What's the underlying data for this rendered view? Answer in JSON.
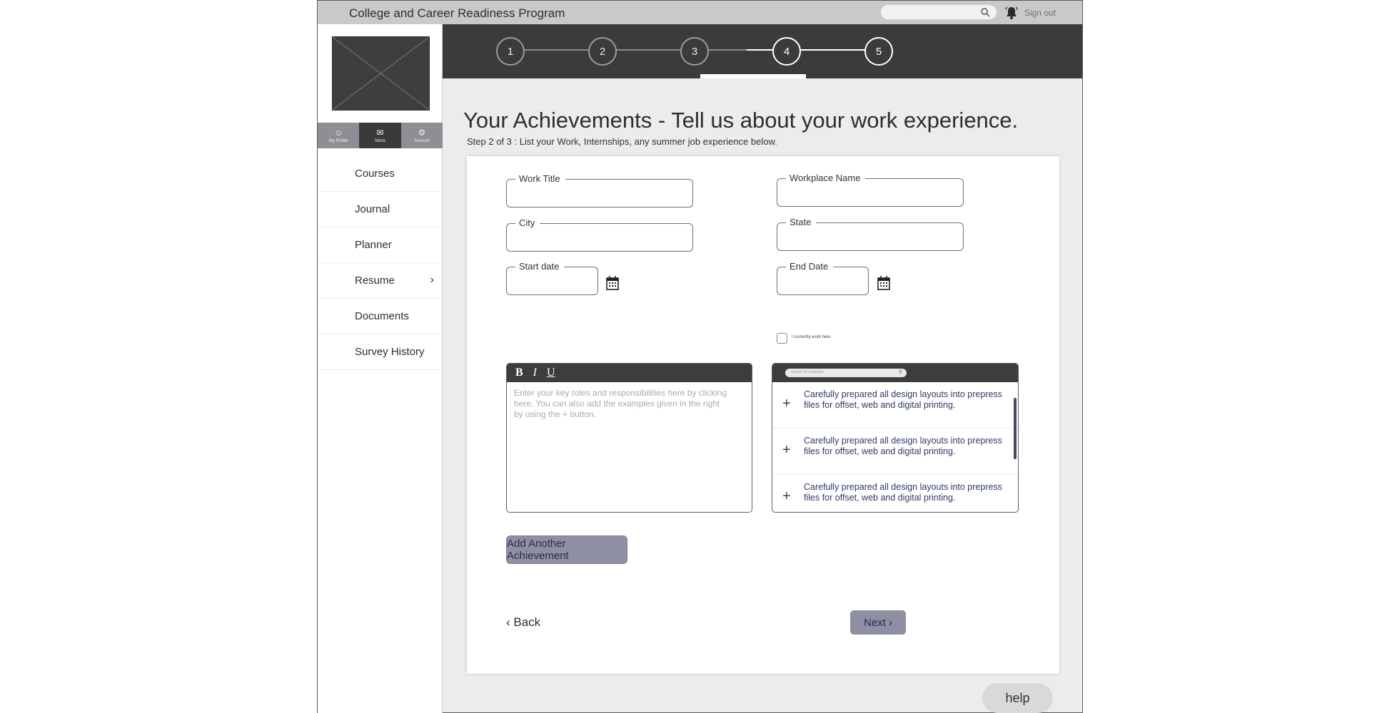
{
  "app": {
    "title": "College and Career Readiness Program",
    "signout_label": "Sign out"
  },
  "sidebar": {
    "icons": [
      {
        "label": "My Profile",
        "glyph": "☺"
      },
      {
        "label": "Inbox",
        "glyph": "✉"
      },
      {
        "label": "Account",
        "glyph": "⚙"
      }
    ],
    "items": [
      {
        "label": "Courses"
      },
      {
        "label": "Journal"
      },
      {
        "label": "Planner"
      },
      {
        "label": "Resume",
        "chevron": "›"
      },
      {
        "label": "Documents"
      },
      {
        "label": "Survey History"
      }
    ]
  },
  "stepper": {
    "steps": [
      "1",
      "2",
      "3",
      "4",
      "5"
    ],
    "current": "3"
  },
  "page": {
    "title": "Your Achievements - Tell us about your work experience.",
    "subtitle": "Step 2 of 3 : List your Work, Internships, any summer job experience below."
  },
  "form": {
    "work_title": "Work Title",
    "workplace_name": "Workplace Name",
    "city": "City",
    "state": "State",
    "start_date": "Start date",
    "end_date": "End Date",
    "currently_work": "I currently work here."
  },
  "editor": {
    "bold": "B",
    "italic": "I",
    "underline": "U",
    "placeholder": "Enter your key roles and responsibilities here by clicking here. You can also add the examples given in the right by using the + button."
  },
  "examples": {
    "search_placeholder": "Search for examples",
    "items": [
      "Carefully prepared all design layouts into prepress files for offset, web and digital printing.",
      "Carefully prepared all design layouts into prepress files for offset, web and digital printing.",
      "Carefully prepared all design layouts into prepress files for offset, web and digital printing."
    ]
  },
  "buttons": {
    "add_another": "Add Another Achievement",
    "back": "‹ Back",
    "next": "Next ›",
    "help": "help"
  }
}
